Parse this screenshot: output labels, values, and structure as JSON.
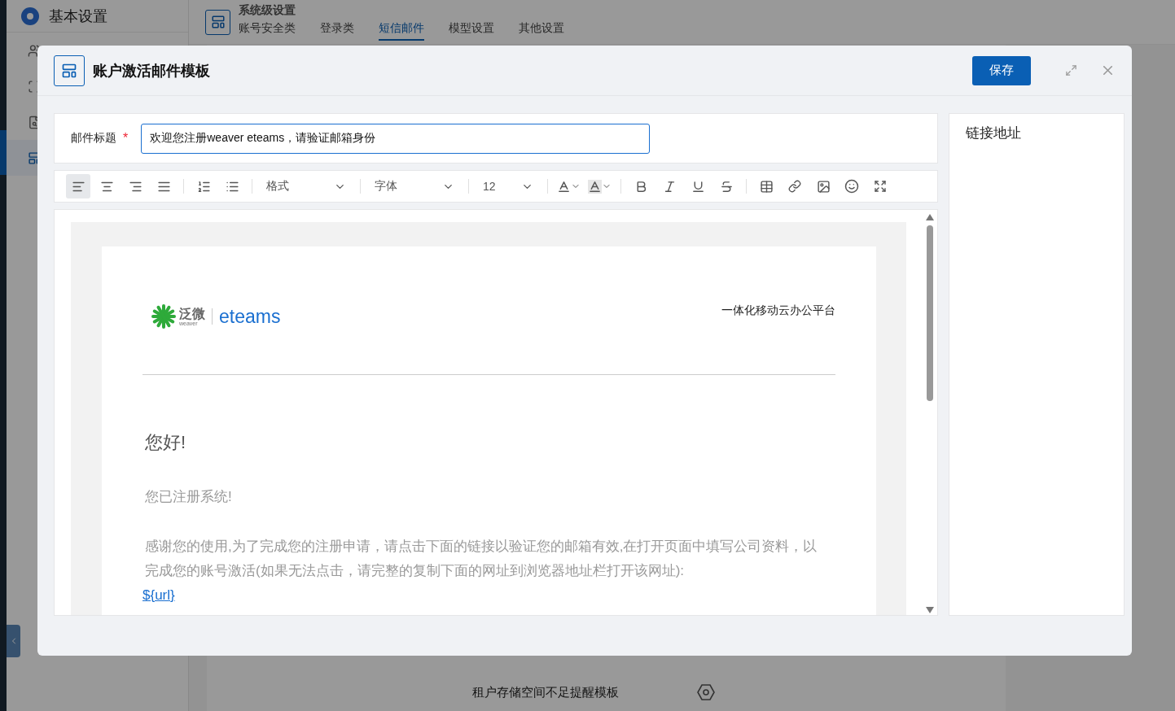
{
  "sidebar": {
    "title": "基本设置",
    "items": [
      {
        "selected": false
      },
      {
        "selected": false
      },
      {
        "selected": false
      },
      {
        "selected": true
      }
    ]
  },
  "header": {
    "title": "系统级设置",
    "tabs": [
      {
        "label": "账号安全类",
        "selected": false
      },
      {
        "label": "登录类",
        "selected": false
      },
      {
        "label": "短信邮件",
        "selected": true
      },
      {
        "label": "模型设置",
        "selected": false
      },
      {
        "label": "其他设置",
        "selected": false
      }
    ]
  },
  "content": {
    "row_label": "租户存储空间不足提醒模板"
  },
  "dialog": {
    "title": "账户激活邮件模板",
    "save_button": "保存",
    "subject": {
      "label": "邮件标题",
      "required_mark": "*",
      "value": "欢迎您注册weaver eteams，请验证邮箱身份"
    },
    "toolbar": {
      "alignments": [
        {
          "selected": true
        },
        {
          "selected": false
        },
        {
          "selected": false
        },
        {
          "selected": false
        }
      ],
      "format": "格式",
      "font": "字体",
      "size": "12"
    },
    "email": {
      "logo_text": "泛微",
      "logo_subtext": "weaver",
      "brand": "eteams",
      "tagline": "一体化移动云办公平台",
      "greeting": "您好!",
      "notice": "您已注册系统!",
      "body": "感谢您的使用,为了完成您的注册申请，请点击下面的链接以验证您的邮箱有效,在打开页面中填写公司资料，以完成您的账号激活(如果无法点击，请完整的复制下面的网址到浏览器地址栏打开该网址):",
      "link": "${url}"
    },
    "side_panel": {
      "title": "链接地址"
    }
  }
}
